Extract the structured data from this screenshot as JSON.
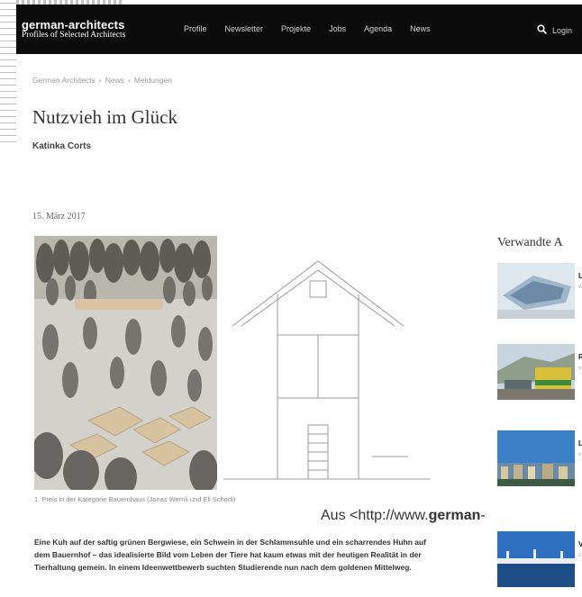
{
  "header": {
    "logo_name": "german-architects",
    "logo_tagline": "Profiles of Selected Architects",
    "nav": [
      "Profile",
      "Newsletter",
      "Projekte",
      "Jobs",
      "Agenda",
      "News"
    ],
    "login_label": "Login"
  },
  "breadcrumb": [
    "German Architects",
    "News",
    "Meldungen"
  ],
  "article": {
    "title": "Nutzvieh im Glück",
    "author": "Katinka Corts",
    "date": "15. März 2017",
    "caption": "1. Preis in der Kategorie Bauernhaus (Jonas Wernli und Eli Schorli)",
    "body": "Eine Kuh auf der saftig grünen Bergwiese, ein Schwein in der Schlammsuhle und ein scharrendes Huhn auf dem Bauernhof – das idealisierte Bild vom Leben der Tiere hat kaum etwas mit der heutigen Realität in der Tierhaltung gemein. In einem Ideenwettbewerb suchten Studierende nun nach dem goldenen Mittelweg."
  },
  "source_overlay": {
    "prefix": "Aus <http://www.",
    "bold": "german",
    "suffix": "-"
  },
  "related": {
    "heading": "Verwandte A",
    "items": [
      {
        "title": "L",
        "meta": "v",
        "thumb_icon": "building-thumbnail"
      },
      {
        "title": "R",
        "meta": "v",
        "thumb_icon": "train-thumbnail"
      },
      {
        "title": "L",
        "meta": "v",
        "thumb_icon": "city-thumbnail"
      },
      {
        "title": "V",
        "meta": "c",
        "thumb_icon": "bridge-thumbnail"
      }
    ]
  },
  "colors": {
    "header_bg": "#0b0b0b",
    "page_bg": "#ffffff",
    "text": "#222222",
    "muted": "#9a9a9a"
  }
}
